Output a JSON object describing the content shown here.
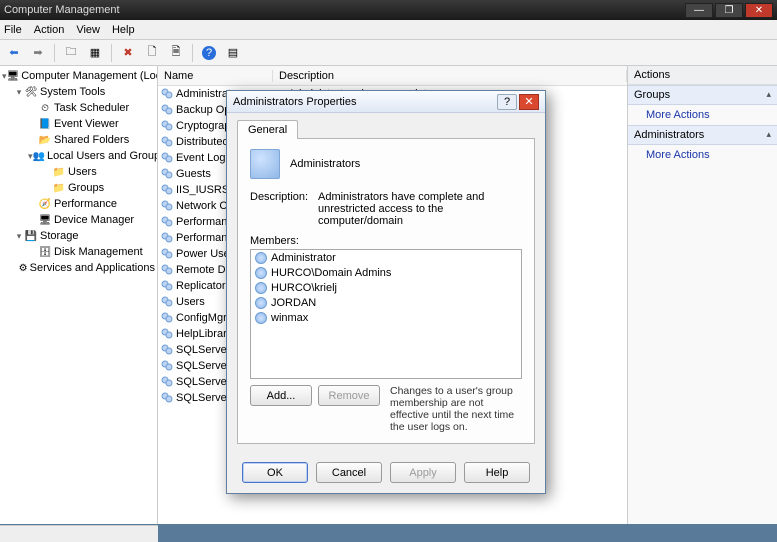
{
  "window": {
    "title": "Computer Management",
    "controls": {
      "min": "—",
      "max": "❐",
      "close": "✕"
    }
  },
  "menu": {
    "items": [
      "File",
      "Action",
      "View",
      "Help"
    ]
  },
  "toolbar": {
    "back": "⬅",
    "forward": "➡",
    "up": "⭮",
    "props": "▦",
    "delete": "✖",
    "refresh": "🗋",
    "export": "🗎",
    "help": "?",
    "views": "▤"
  },
  "tree": [
    {
      "exp": "▾",
      "icon": "🖥",
      "label": "Computer Management (Local",
      "ind": 0
    },
    {
      "exp": "▾",
      "icon": "🛠",
      "label": "System Tools",
      "ind": 1
    },
    {
      "exp": "",
      "icon": "⏲",
      "label": "Task Scheduler",
      "ind": 2
    },
    {
      "exp": "",
      "icon": "📘",
      "label": "Event Viewer",
      "ind": 2
    },
    {
      "exp": "",
      "icon": "📂",
      "label": "Shared Folders",
      "ind": 2
    },
    {
      "exp": "▾",
      "icon": "👥",
      "label": "Local Users and Groups",
      "ind": 2
    },
    {
      "exp": "",
      "icon": "📁",
      "label": "Users",
      "ind": 3
    },
    {
      "exp": "",
      "icon": "📁",
      "label": "Groups",
      "ind": 3
    },
    {
      "exp": "",
      "icon": "🧭",
      "label": "Performance",
      "ind": 2
    },
    {
      "exp": "",
      "icon": "🖥",
      "label": "Device Manager",
      "ind": 2
    },
    {
      "exp": "▾",
      "icon": "💾",
      "label": "Storage",
      "ind": 1
    },
    {
      "exp": "",
      "icon": "🗄",
      "label": "Disk Management",
      "ind": 2
    },
    {
      "exp": "",
      "icon": "⚙",
      "label": "Services and Applications",
      "ind": 1
    }
  ],
  "list": {
    "headers": {
      "name": "Name",
      "description": "Description"
    },
    "rows": [
      {
        "name": "Administrators",
        "desc": "Administrators have complete an..."
      },
      {
        "name": "Backup Ope",
        "desc": ""
      },
      {
        "name": "Cryptograph",
        "desc": ""
      },
      {
        "name": "Distributed C",
        "desc": ""
      },
      {
        "name": "Event Log Re",
        "desc": ""
      },
      {
        "name": "Guests",
        "desc": ""
      },
      {
        "name": "IIS_IUSRS",
        "desc": ""
      },
      {
        "name": "Network Co",
        "desc": ""
      },
      {
        "name": "Performance",
        "desc": ""
      },
      {
        "name": "Performance",
        "desc": ""
      },
      {
        "name": "Power Users",
        "desc": ""
      },
      {
        "name": "Remote Desk",
        "desc": ""
      },
      {
        "name": "Replicator",
        "desc": ""
      },
      {
        "name": "Users",
        "desc": ""
      },
      {
        "name": "ConfigMgr R",
        "desc": ""
      },
      {
        "name": "HelpLibraryU",
        "desc": ""
      },
      {
        "name": "SQLServer200",
        "desc": ""
      },
      {
        "name": "SQLServerMS",
        "desc": ""
      },
      {
        "name": "SQLServerMS",
        "desc": ""
      },
      {
        "name": "SQLServerSQ",
        "desc": ""
      }
    ]
  },
  "actions": {
    "header": "Actions",
    "sections": [
      {
        "title": "Groups",
        "links": [
          "More Actions"
        ]
      },
      {
        "title": "Administrators",
        "links": [
          "More Actions"
        ]
      }
    ]
  },
  "dialog": {
    "title": "Administrators Properties",
    "help_glyph": "?",
    "close_glyph": "✕",
    "tabs": [
      "General"
    ],
    "group_name": "Administrators",
    "description_label": "Description:",
    "description_value": "Administrators have complete and unrestricted access to the computer/domain",
    "members_label": "Members:",
    "members": [
      "Administrator",
      "HURCO\\Domain Admins",
      "HURCO\\krielj",
      "JORDAN",
      "winmax"
    ],
    "add_label": "Add...",
    "remove_label": "Remove",
    "note": "Changes to a user's group membership are not effective until the next time the user logs on.",
    "buttons": {
      "ok": "OK",
      "cancel": "Cancel",
      "apply": "Apply",
      "help": "Help"
    }
  }
}
